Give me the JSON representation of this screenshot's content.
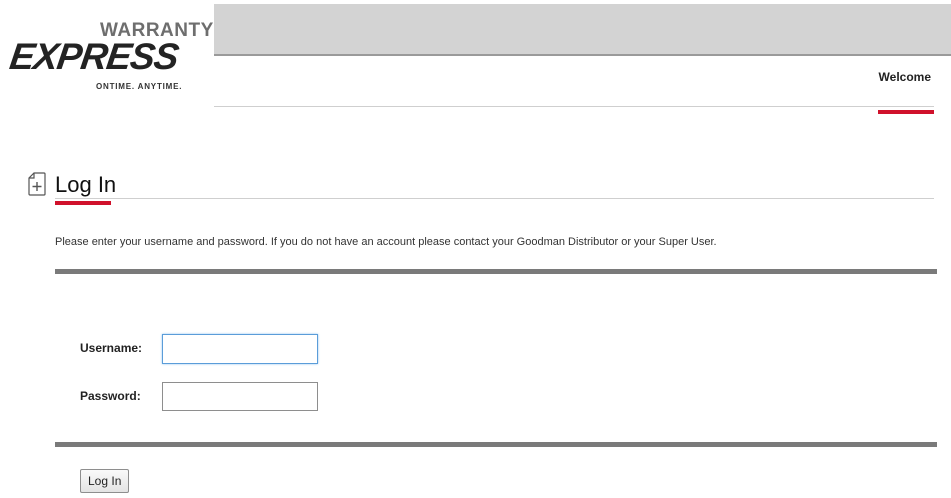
{
  "logo": {
    "line1": "WARRANTY",
    "line2": "EXPRESS",
    "tagline": "ONTIME. ANYTIME."
  },
  "nav": {
    "items": [
      {
        "label": "Welcome",
        "active": true
      }
    ]
  },
  "colors": {
    "accent": "#d0112b",
    "top_bar": "#d3d3d3",
    "rule": "#7a7a7a"
  },
  "page": {
    "icon": "new-document-icon",
    "title": "Log In",
    "instructions": "Please enter your username and password. If you do not have an account please contact your Goodman Distributor or your Super User."
  },
  "form": {
    "username_label": "Username:",
    "username_value": "",
    "password_label": "Password:",
    "password_value": "",
    "submit_label": "Log In"
  }
}
